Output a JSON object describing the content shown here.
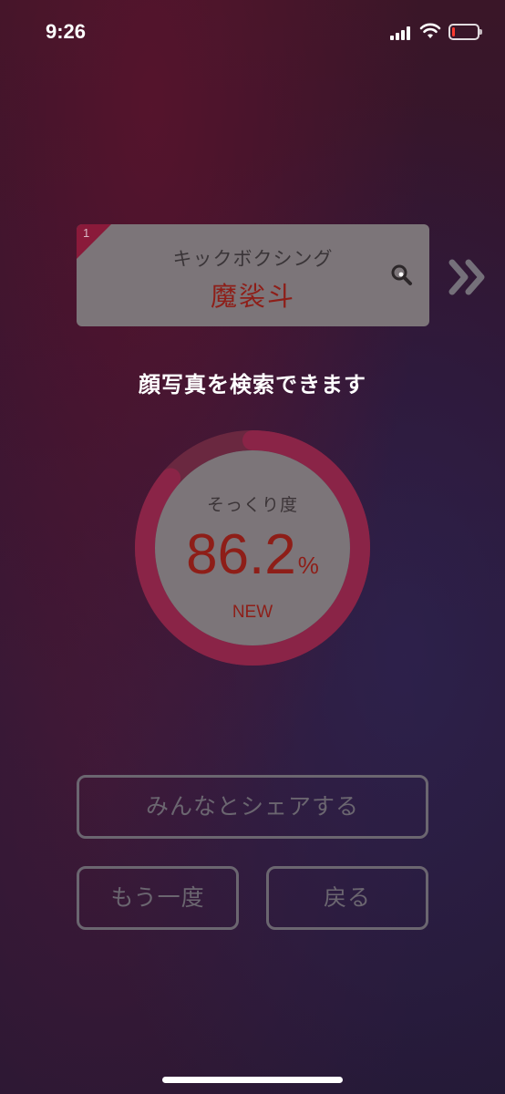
{
  "status_bar": {
    "time": "9:26",
    "battery_level": 0.1,
    "battery_color": "#ff3b30"
  },
  "result_card": {
    "rank": "1",
    "category": "キックボクシング",
    "name": "魔裟斗",
    "search_icon": "search-icon",
    "next_icon": "double-chevron-right-icon"
  },
  "caption": "顔写真を検索できます",
  "similarity": {
    "label": "そっくり度",
    "value": "86.2",
    "unit": "%",
    "badge": "NEW",
    "ring_fraction": 0.862,
    "ring_color": "#8a2447",
    "ring_track_color": "#6a2840"
  },
  "buttons": {
    "share": "みんなとシェアする",
    "retry": "もう一度",
    "back": "戻る"
  },
  "colors": {
    "accent_red": "#8e1e18",
    "card_bg": "#7c7579",
    "button_border": "#6b6670"
  }
}
